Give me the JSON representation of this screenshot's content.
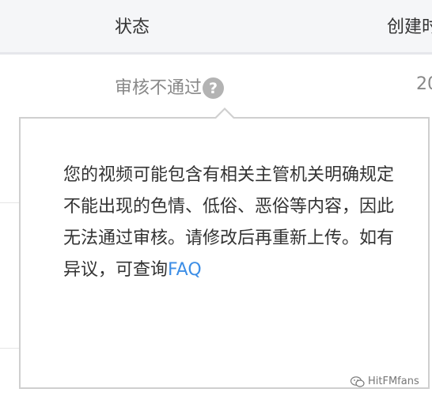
{
  "table": {
    "headers": {
      "status": "状态",
      "created": "创建时"
    },
    "row": {
      "status": "审核不通过",
      "created": "20"
    }
  },
  "tooltip": {
    "message": "您的视频可能包含有相关主管机关明确规定不能出现的色情、低俗、恶俗等内容，因此无法通过审核。请修改后再重新上传。如有异议，可查询",
    "link_label": "FAQ"
  },
  "watermark": {
    "text": "HitFMfans"
  },
  "icons": {
    "help": "question-mark-icon",
    "watermark": "wechat-icon"
  },
  "colors": {
    "link": "#3d8ee6",
    "header_bg": "#f5f6f8",
    "status_text": "#888888"
  }
}
